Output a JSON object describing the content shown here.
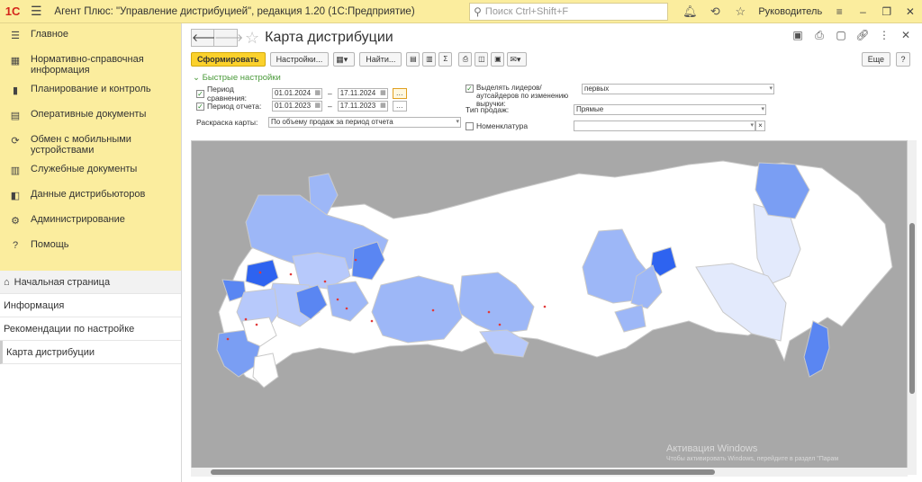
{
  "titlebar": {
    "logo": "1С",
    "app_title": "Агент Плюс: \"Управление дистрибуцией\", редакция 1.20  (1С:Предприятие)",
    "search_placeholder": "Поиск Ctrl+Shift+F",
    "user": "Руководитель"
  },
  "sidebar": {
    "sections": [
      {
        "label": "Главное",
        "icon": "menu-icon"
      },
      {
        "label": "Нормативно-справочная информация",
        "icon": "catalog-icon"
      },
      {
        "label": "Планирование и контроль",
        "icon": "chart-icon"
      },
      {
        "label": "Оперативные документы",
        "icon": "documents-icon"
      },
      {
        "label": "Обмен с мобильными устройствами",
        "icon": "sync-icon"
      },
      {
        "label": "Служебные документы",
        "icon": "service-docs-icon"
      },
      {
        "label": "Данные дистрибьюторов",
        "icon": "distributors-icon"
      },
      {
        "label": "Администрирование",
        "icon": "gear-icon"
      },
      {
        "label": "Помощь",
        "icon": "help-icon"
      }
    ],
    "links": [
      {
        "label": "Начальная страница",
        "icon": "home-icon"
      },
      {
        "label": "Информация"
      },
      {
        "label": "Рекомендации по настройке"
      },
      {
        "label": "Карта дистрибуции"
      }
    ]
  },
  "page": {
    "title": "Карта дистрибуции"
  },
  "toolbar": {
    "form_button": "Сформировать",
    "settings_button": "Настройки...",
    "find_button": "Найти...",
    "more_button": "Еще",
    "help_button": "?"
  },
  "filters": {
    "quick_settings": "Быстрые настройки",
    "comparison_period_label": "Период сравнения:",
    "comparison_from": "01.01.2024",
    "comparison_to": "17.11.2024",
    "report_period_label": "Период отчета:",
    "report_from": "01.01.2023",
    "report_to": "17.11.2023",
    "dash": "–",
    "map_coloring_label": "Раскраска карты:",
    "map_coloring_value": "По объему продаж за период отчета",
    "highlight_label": "Выделять лидеров/аутсайдеров по изменению выручки:",
    "highlight_value": "первых",
    "sale_type_label": "Тип продаж:",
    "sale_type_value": "Прямые",
    "nomenclature_label": "Номенклатура",
    "nomenclature_value": ""
  },
  "map": {
    "colors": {
      "background": "#a8a8a8",
      "no_data": "#ffffff",
      "level1": "#e3eafc",
      "level2": "#b7c9fb",
      "level3": "#9db7f7",
      "level4": "#7a9ef3",
      "level5": "#5a86f2",
      "level6": "#2e63f0",
      "border": "#c9c9c9",
      "marker": "#e23a3a"
    }
  },
  "watermark": {
    "title": "Активация Windows",
    "subtitle": "Чтобы активировать Windows, перейдите в раздел \"Парам"
  }
}
